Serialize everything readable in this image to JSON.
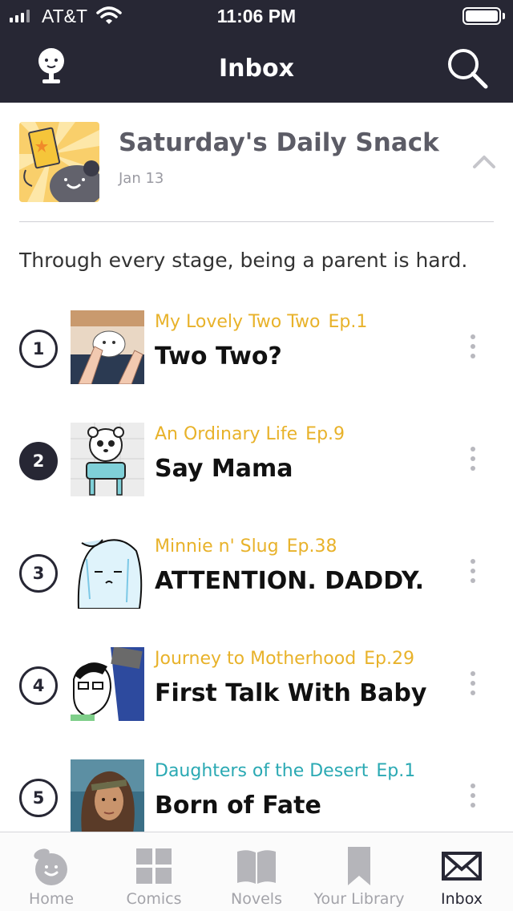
{
  "status_bar": {
    "carrier": "AT&T",
    "time": "11:06 PM",
    "battery_level": 1.0
  },
  "header": {
    "title": "Inbox",
    "left_icon": "profile-icon",
    "right_icon": "search-icon"
  },
  "snack": {
    "title": "Saturday's Daily Snack",
    "date": "Jan 13",
    "description": "Through every stage, being a parent is hard."
  },
  "episodes": [
    {
      "rank": "1",
      "series": "My Lovely Two Two",
      "ep": "Ep.1",
      "title": "Two Two?",
      "series_color": "#e8b22a"
    },
    {
      "rank": "2",
      "series": "An Ordinary Life",
      "ep": "Ep.9",
      "title": "Say Mama",
      "series_color": "#e8b22a"
    },
    {
      "rank": "3",
      "series": "Minnie n' Slug",
      "ep": "Ep.38",
      "title": "ATTENTION. DADDY.",
      "series_color": "#e8b22a"
    },
    {
      "rank": "4",
      "series": "Journey to Motherhood",
      "ep": "Ep.29",
      "title": "First Talk With Baby",
      "series_color": "#e8b22a"
    },
    {
      "rank": "5",
      "series": "Daughters of the Desert",
      "ep": "Ep.1",
      "title": "Born of Fate",
      "series_color": "#2aa9b3"
    }
  ],
  "tabs": [
    {
      "label": "Home",
      "icon": "home-icon",
      "active": false
    },
    {
      "label": "Comics",
      "icon": "comics-icon",
      "active": false
    },
    {
      "label": "Novels",
      "icon": "novels-icon",
      "active": false
    },
    {
      "label": "Your Library",
      "icon": "library-icon",
      "active": false
    },
    {
      "label": "Inbox",
      "icon": "inbox-icon",
      "active": true
    }
  ],
  "colors": {
    "header_bg": "#272734",
    "accent_gold": "#e8b22a",
    "accent_teal": "#2aa9b3"
  }
}
